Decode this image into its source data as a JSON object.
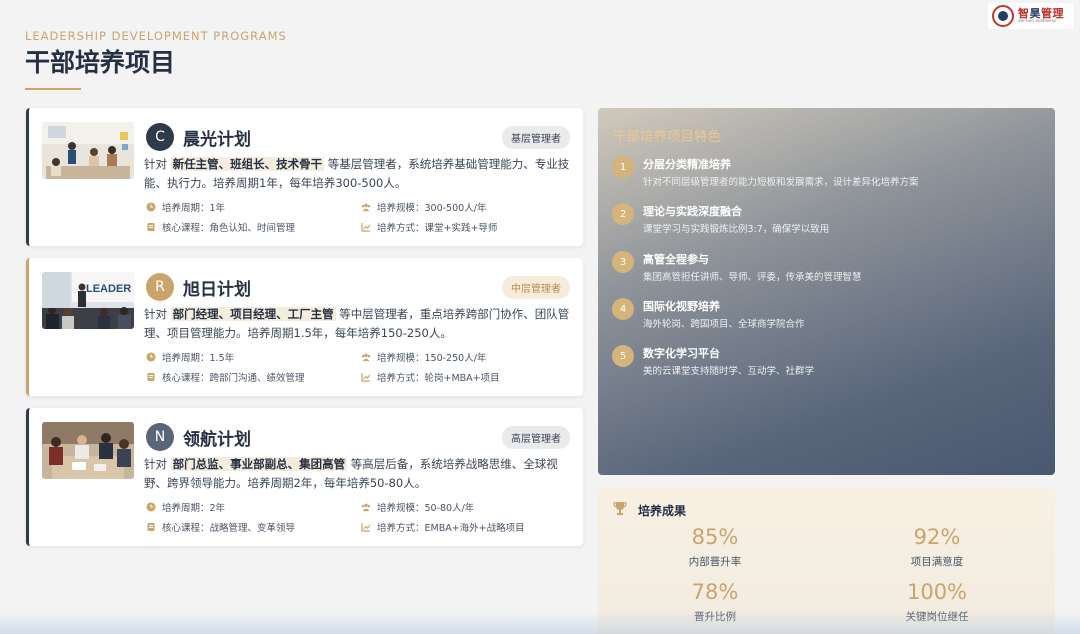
{
  "header": {
    "subtitle": "LEADERSHIP DEVELOPMENT PROGRAMS",
    "title": "干部培养项目"
  },
  "logo": {
    "name_red": "智",
    "name_blue": "昊",
    "name_rest": "管理",
    "en": "ZHI HAO SUPERVISE",
    "colors": {
      "red": "#b5322a",
      "blue": "#2a3a66"
    }
  },
  "colors": {
    "accent_gold": "#c9a56a",
    "navy": "#2f3a4b",
    "badge_c": "#2f3a4b",
    "badge_r": "#c9a56a",
    "badge_n": "#59667a"
  },
  "programs": [
    {
      "badge": "C",
      "name": "晨光计划",
      "level": "基层管理者",
      "desc_prefix": "针对 ",
      "desc_highlight": "新任主管、班组长、技术骨干",
      "desc_suffix": " 等基层管理者，系统培养基础管理能力、专业技能、执行力。培养周期1年，每年培养300-500人。",
      "cycle": "培养周期：1年",
      "scale": "培养规模：300-500人/年",
      "courses": "核心课程：角色认知、时间管理",
      "method": "培养方式：课堂+实践+导师"
    },
    {
      "badge": "R",
      "name": "旭日计划",
      "level": "中层管理者",
      "desc_prefix": "针对 ",
      "desc_highlight": "部门经理、项目经理、工厂主管",
      "desc_suffix": " 等中层管理者，重点培养跨部门协作、团队管理、项目管理能力。培养周期1.5年，每年培养150-250人。",
      "cycle": "培养周期：1.5年",
      "scale": "培养规模：150-250人/年",
      "courses": "核心课程：跨部门沟通、绩效管理",
      "method": "培养方式：轮岗+MBA+项目"
    },
    {
      "badge": "N",
      "name": "领航计划",
      "level": "高层管理者",
      "desc_prefix": "针对 ",
      "desc_highlight": "部门总监、事业部副总、集团高管",
      "desc_suffix": " 等高层后备，系统培养战略思维、全球视野、跨界领导能力。培养周期2年，每年培养50-80人。",
      "cycle": "培养周期：2年",
      "scale": "培养规模：50-80人/年",
      "courses": "核心课程：战略管理、变革领导",
      "method": "培养方式：EMBA+海外+战略项目"
    }
  ],
  "features": {
    "title": "干部培养项目特色",
    "items": [
      {
        "num": "1",
        "title": "分层分类精准培养",
        "desc": "针对不同层级管理者的能力短板和发展需求，设计差异化培养方案"
      },
      {
        "num": "2",
        "title": "理论与实践深度融合",
        "desc": "课堂学习与实践锻炼比例3:7，确保学以致用"
      },
      {
        "num": "3",
        "title": "高管全程参与",
        "desc": "集团高管担任讲师、导师、评委，传承美的管理智慧"
      },
      {
        "num": "4",
        "title": "国际化视野培养",
        "desc": "海外轮岗、跨国项目、全球商学院合作"
      },
      {
        "num": "5",
        "title": "数字化学习平台",
        "desc": "美的云课堂支持随时学、互动学、社群学"
      }
    ]
  },
  "results": {
    "title": "培养成果",
    "stats": [
      {
        "value": "85%",
        "label": "内部晋升率"
      },
      {
        "value": "92%",
        "label": "项目满意度"
      },
      {
        "value": "78%",
        "label": "晋升比例"
      },
      {
        "value": "100%",
        "label": "关键岗位继任"
      }
    ]
  }
}
